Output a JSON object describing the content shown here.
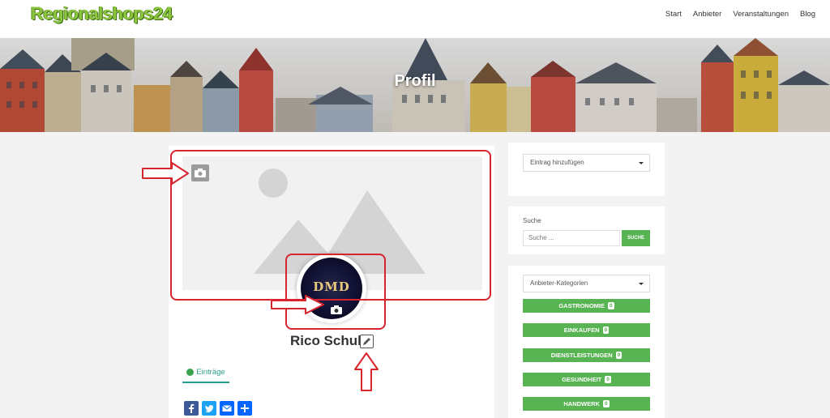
{
  "header": {
    "logo": "Regionalshops24",
    "nav": [
      "Start",
      "Anbieter",
      "Veranstaltungen",
      "Blog"
    ]
  },
  "banner": {
    "title": "Profil"
  },
  "profile": {
    "avatar_text": "DMD",
    "name": "Rico Schulz",
    "tab_label": "Einträge"
  },
  "share": {
    "buttons": [
      "facebook-icon",
      "twitter-icon",
      "email-icon",
      "plus-icon"
    ],
    "colors": {
      "facebook": "#3b5998",
      "twitter": "#1da1f2",
      "email": "#0166ff",
      "plus": "#0166ff"
    }
  },
  "sidebar": {
    "entry_select": "Eintrag hinzufügen",
    "search_title": "Suche",
    "search_placeholder": "Suche ...",
    "search_button": "SUCHE",
    "category_select": "Anbieter-Kategorien",
    "categories": [
      {
        "label": "GASTRONOMIE",
        "count": "0"
      },
      {
        "label": "EINKAUFEN",
        "count": "0"
      },
      {
        "label": "DIENSTLEISTUNGEN",
        "count": "0"
      },
      {
        "label": "GESUNDHEIT",
        "count": "0"
      },
      {
        "label": "HANDWERK",
        "count": "0"
      }
    ]
  },
  "colors": {
    "accent": "#58b452",
    "annotation": "#d8242c",
    "tab": "#2b9f8e"
  }
}
